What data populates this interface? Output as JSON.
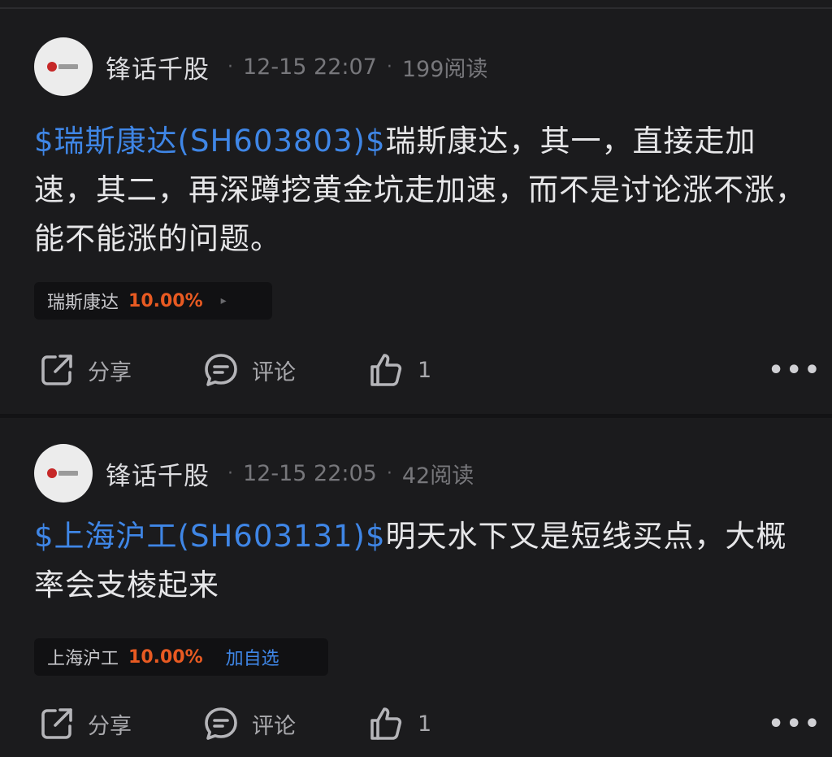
{
  "posts": [
    {
      "author": "锋话千股",
      "time": "12-15 22:07",
      "reads": "199阅读",
      "ticker": "$瑞斯康达(SH603803)$",
      "text": "瑞斯康达，其一，直接走加速，其二，再深蹲挖黄金坑走加速，而不是讨论涨不涨，能不能涨的问题。",
      "chip": {
        "name": "瑞斯康达",
        "change": "10.00%",
        "arrow": "▸"
      },
      "actions": {
        "share": "分享",
        "comment": "评论",
        "like_count": "1",
        "more": "•••"
      }
    },
    {
      "author": "锋话千股",
      "time": "12-15 22:05",
      "reads": "42阅读",
      "ticker": "$上海沪工(SH603131)$",
      "text": "明天水下又是短线买点，大概率会支棱起来",
      "chip": {
        "name": "上海沪工",
        "change": "10.00%",
        "watch": "加自选"
      },
      "actions": {
        "share": "分享",
        "comment": "评论",
        "like_count": "1",
        "more": "•••"
      }
    }
  ],
  "icons": {
    "share": "share-icon",
    "comment": "comment-icon",
    "like": "thumbs-up-icon",
    "more": "more-icon"
  },
  "colors": {
    "background": "#1b1b1d",
    "ticker_link": "#3f86e6",
    "gain": "#e85a22"
  }
}
